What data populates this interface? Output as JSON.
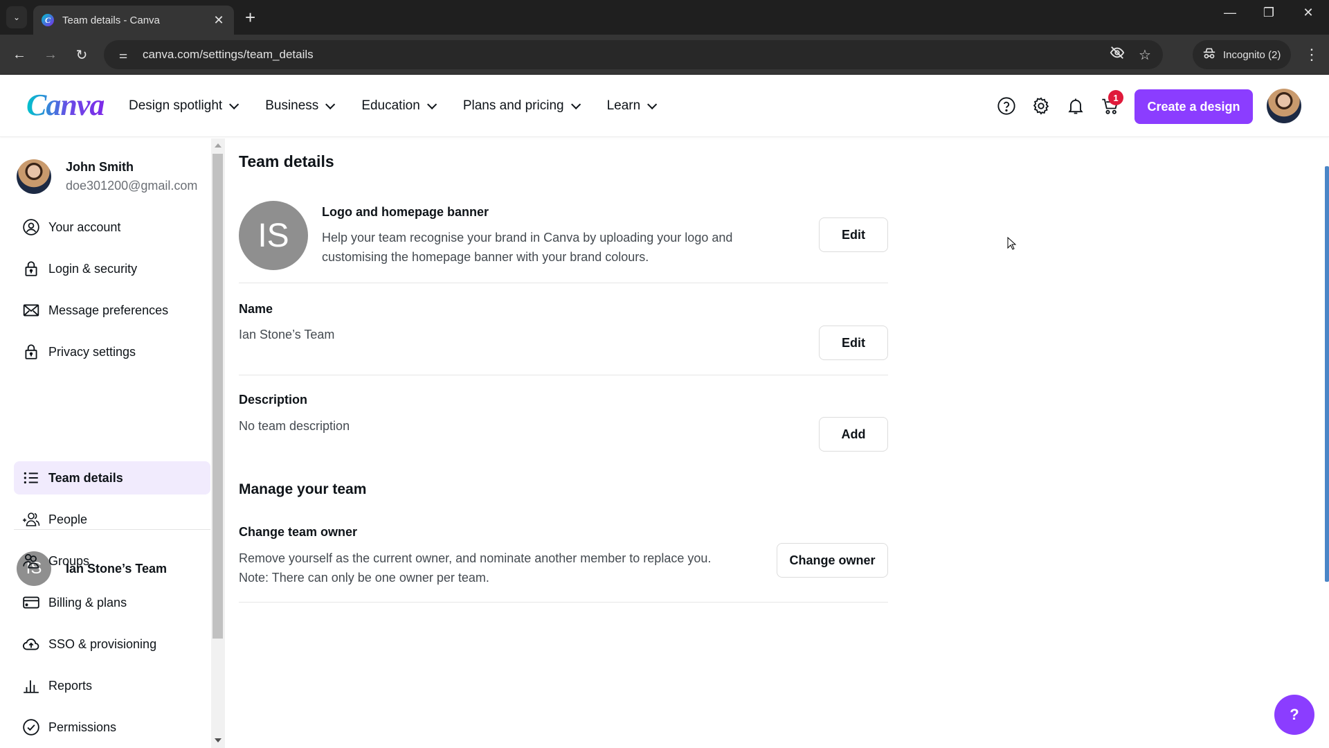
{
  "browser": {
    "tab_title": "Team details - Canva",
    "url": "canva.com/settings/team_details",
    "incognito_label": "Incognito (2)",
    "icons": {
      "tab_search": "chevron-down-icon",
      "new_tab": "plus-icon",
      "back": "arrow-left-icon",
      "forward": "arrow-right-icon",
      "reload": "reload-icon",
      "site_info": "tune-icon",
      "tracking": "eye-off-icon",
      "bookmark": "star-icon",
      "menu": "kebab-icon"
    },
    "glyphs": {
      "tab_search": "⌄",
      "favicon": "C",
      "close": "✕",
      "new_tab": "+",
      "minimize": "—",
      "restore": "❐",
      "window_close": "✕",
      "back": "←",
      "forward": "→",
      "reload": "↻",
      "site_info": "⚌",
      "eye_off": "◎",
      "star": "☆",
      "incognito": "🕶",
      "kebab": "⋮"
    }
  },
  "header": {
    "logo": "Canva",
    "nav": [
      {
        "label": "Design spotlight"
      },
      {
        "label": "Business"
      },
      {
        "label": "Education"
      },
      {
        "label": "Plans and pricing"
      },
      {
        "label": "Learn"
      }
    ],
    "cart_count": "1",
    "create_label": "Create a design",
    "accent_color": "#8b3dff",
    "badge_color": "#e0193a"
  },
  "sidebar": {
    "user": {
      "name": "John Smith",
      "email": "doe301200@gmail.com"
    },
    "account_items": [
      {
        "label": "Your account",
        "icon": "user-circle-icon"
      },
      {
        "label": "Login & security",
        "icon": "lock-icon"
      },
      {
        "label": "Message preferences",
        "icon": "envelope-icon"
      },
      {
        "label": "Privacy settings",
        "icon": "lock-icon"
      }
    ],
    "team": {
      "initials": "IS",
      "name": "Ian Stone’s Team"
    },
    "team_items": [
      {
        "label": "Team details",
        "icon": "list-icon",
        "active": true
      },
      {
        "label": "People",
        "icon": "add-people-icon"
      },
      {
        "label": "Groups",
        "icon": "groups-icon"
      },
      {
        "label": "Billing & plans",
        "icon": "credit-card-icon"
      },
      {
        "label": "SSO & provisioning",
        "icon": "cloud-upload-icon"
      },
      {
        "label": "Reports",
        "icon": "bar-chart-icon"
      },
      {
        "label": "Permissions",
        "icon": "check-circle-icon"
      }
    ]
  },
  "main": {
    "title": "Team details",
    "logo_section": {
      "initials": "IS",
      "label": "Logo and homepage banner",
      "description_line1": "Help your team recognise your brand in Canva by uploading your logo and",
      "description_line2": "customising the homepage banner with your brand colours.",
      "button": "Edit"
    },
    "name_section": {
      "label": "Name",
      "value": "Ian Stone’s Team",
      "button": "Edit"
    },
    "description_section": {
      "label": "Description",
      "value": "No team description",
      "button": "Add"
    },
    "manage": {
      "title": "Manage your team",
      "label": "Change team owner",
      "description_line1": "Remove yourself as the current owner, and nominate another member to replace you.",
      "description_line2": "Note: There can only be one owner per team.",
      "button": "Change owner"
    }
  },
  "help_fab": "?"
}
